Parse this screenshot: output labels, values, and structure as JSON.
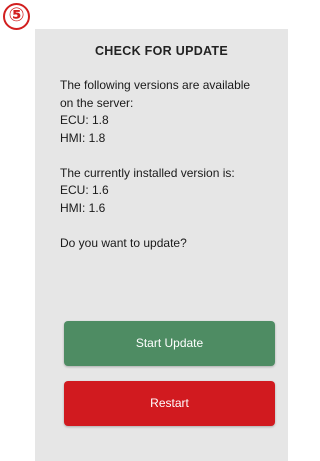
{
  "step_badge": "⑤",
  "dialog": {
    "title": "CHECK FOR UPDATE",
    "available_intro_1": "The following versions are available",
    "available_intro_2": "on the server:",
    "server_ecu": "ECU: 1.8",
    "server_hmi": "HMI: 1.8",
    "installed_intro": "The currently installed version is:",
    "installed_ecu": "ECU: 1.6",
    "installed_hmi": "HMI: 1.6",
    "question": "Do you want to update?"
  },
  "buttons": {
    "start_update": "Start Update",
    "restart": "Restart"
  },
  "colors": {
    "badge": "#d21f1f",
    "panel_bg": "#e6e6e6",
    "start_update_bg": "#4e8c63",
    "restart_bg": "#d11a1f"
  }
}
